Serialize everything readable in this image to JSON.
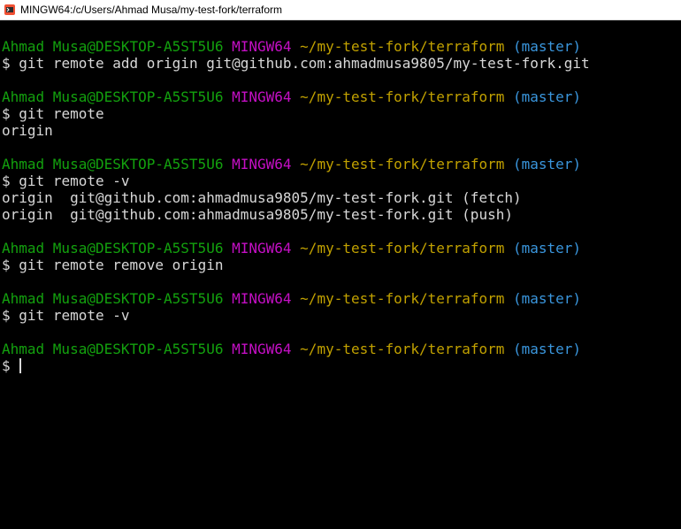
{
  "window": {
    "title": "MINGW64:/c/Users/Ahmad Musa/my-test-fork/terraform"
  },
  "colors": {
    "user": "#13a10e",
    "host": "#c50fc5",
    "path": "#c1a100",
    "branch": "#3a96dd",
    "text": "#d8d8d8",
    "background": "#000000"
  },
  "prompt": {
    "user": "Ahmad Musa@DESKTOP-A5ST5U6",
    "host": "MINGW64",
    "path": "~/my-test-fork/terraform",
    "branch": "(master)",
    "symbol": "$"
  },
  "terminal": {
    "cmd1": "git remote add origin git@github.com:ahmadmusa9805/my-test-fork.git",
    "cmd2": "git remote",
    "out2": "origin",
    "cmd3": "git remote -v",
    "out3a": "origin  git@github.com:ahmadmusa9805/my-test-fork.git (fetch)",
    "out3b": "origin  git@github.com:ahmadmusa9805/my-test-fork.git (push)",
    "cmd4": "git remote remove origin",
    "cmd5": "git remote -v"
  }
}
